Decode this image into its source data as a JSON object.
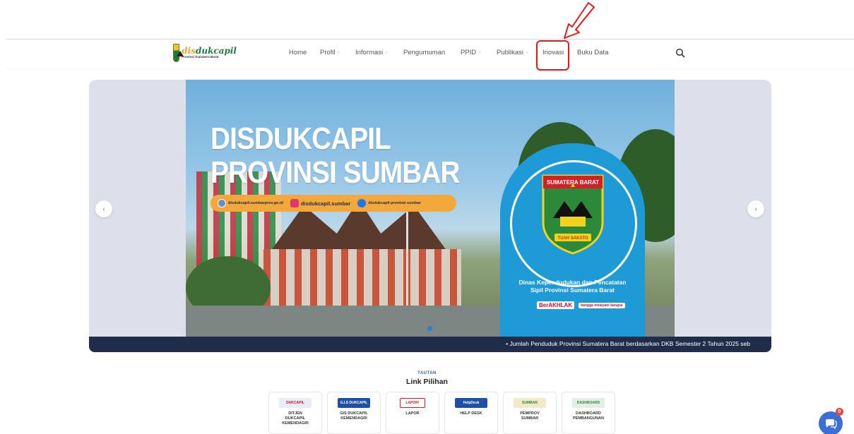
{
  "header": {
    "logo": {
      "brand_prefix": "dis",
      "brand_main": "dukcapil",
      "subtitle": "Provinsi Sumatera Barat"
    },
    "nav": [
      {
        "label": "Home",
        "has_dropdown": false
      },
      {
        "label": "Profil",
        "has_dropdown": true
      },
      {
        "label": "Informasi",
        "has_dropdown": true
      },
      {
        "label": "Pengumuman",
        "has_dropdown": false
      },
      {
        "label": "PPID",
        "has_dropdown": true
      },
      {
        "label": "Publikasi",
        "has_dropdown": true
      },
      {
        "label": "Inovasi",
        "has_dropdown": false
      },
      {
        "label": "Buku Data",
        "has_dropdown": false
      }
    ],
    "caret": "›",
    "search_icon": "search-icon"
  },
  "hero": {
    "title_line1": "DISDUKCAPIL",
    "title_line2": "PROVINSI SUMBAR",
    "social": {
      "website": "disdukcapil.sumbarprov.go.id",
      "instagram": "disdukcapil.sumbar",
      "facebook": "disdukcapil provinsi sumbar"
    },
    "emblem_banner": "SUMATERA BARAT",
    "emblem_ribbon": "TUAH SAKATO",
    "panel_text_1": "Dinas Kependudukan dan Pencatatan",
    "panel_text_2": "Sipil Provinsi Sumatera Barat",
    "berakhlak": "BerAKHLAK",
    "bangga": "bangga melayani bangsa",
    "prev_label": "‹",
    "next_label": "›"
  },
  "ticker": {
    "text": "• Jumlah Penduduk Provinsi Sumatera Barat berdasarkan DKB Semester 2 Tahun 2025 seb"
  },
  "links_section": {
    "eyebrow": "TAUTAN",
    "title": "Link Pilihan",
    "cards": [
      {
        "line1": "DITJEN",
        "line2": "DUKCAPIL",
        "line3": "KEMENDAGRI",
        "logo_text": "DUKCAPIL",
        "logo_color": "#e8edf5"
      },
      {
        "line1": "GIS DUKCAPIL",
        "line2": "KEMENDAGRI",
        "line3": "",
        "logo_text": "G.I.S DUKCAPIL",
        "logo_color": "#1f4fa0"
      },
      {
        "line1": "LAPOR",
        "line2": "",
        "line3": "",
        "logo_text": "LAPOR!",
        "logo_color": "#ffffff"
      },
      {
        "line1": "HELP DESK",
        "line2": "",
        "line3": "",
        "logo_text": "HelpDesk",
        "logo_color": "#1f4fa0"
      },
      {
        "line1": "PEMPROV",
        "line2": "SUMBAR",
        "line3": "",
        "logo_text": "SUMBAR",
        "logo_color": "#f1e9c8"
      },
      {
        "line1": "DASHBOARD",
        "line2": "PEMBANGUNAN",
        "line3": "",
        "logo_text": "DASHBOARD",
        "logo_color": "#e3efe3"
      }
    ]
  },
  "chat": {
    "badge": "0"
  },
  "colors": {
    "accent": "#1e9ad6",
    "highlight": "#e01a1a",
    "ticker_bg": "#1f2d4a",
    "orange": "#f4a83c"
  }
}
